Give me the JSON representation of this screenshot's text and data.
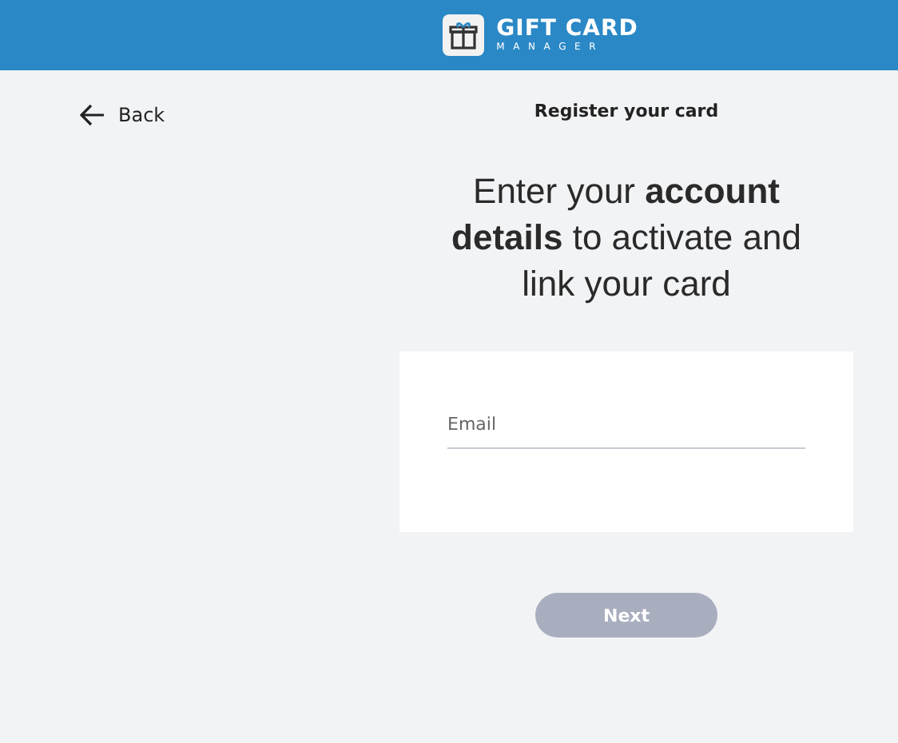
{
  "header": {
    "logo_title": "GIFT CARD",
    "logo_subtitle": "MANAGER"
  },
  "back": {
    "label": "Back"
  },
  "page_title": "Register your card",
  "heading": "Enter your **account details** to activate and link your card",
  "form": {
    "email": {
      "placeholder": "Email"
    }
  },
  "next_button": {
    "label": "Next",
    "disabled": true
  }
}
